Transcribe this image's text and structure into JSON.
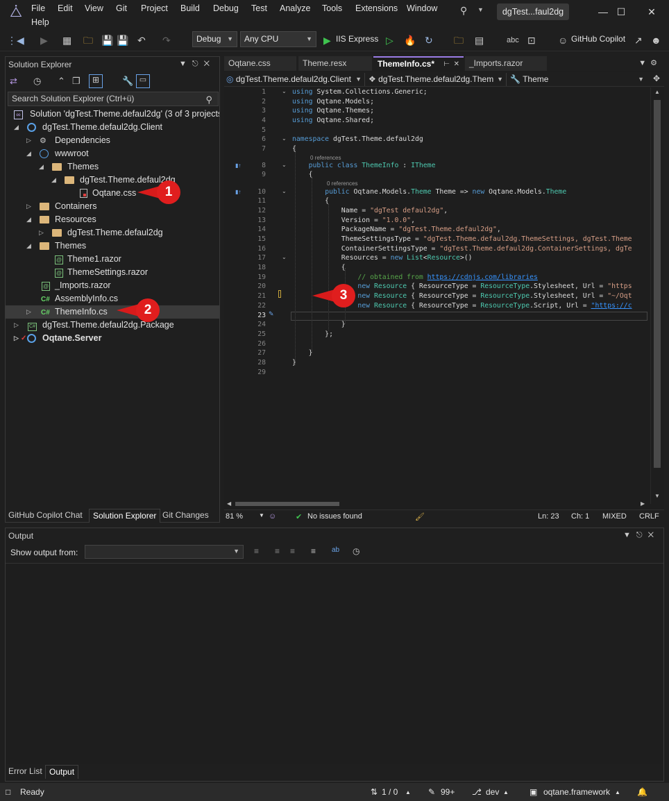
{
  "menu": {
    "items": [
      "File",
      "Edit",
      "View",
      "Git",
      "Project",
      "Build",
      "Debug",
      "Test",
      "Analyze",
      "Tools",
      "Extensions",
      "Window",
      "Help"
    ],
    "doc_title": "dgTest...faul2dg"
  },
  "toolbar": {
    "configuration": "Debug",
    "platform": "Any CPU",
    "run_target": "IIS Express",
    "copilot": "GitHub Copilot"
  },
  "solution_explorer": {
    "title": "Solution Explorer",
    "search_placeholder": "Search Solution Explorer (Ctrl+ü)",
    "rows": [
      {
        "label": "Solution 'dgTest.Theme.defaul2dg' (3 of 3 projects)"
      },
      {
        "label": "dgTest.Theme.defaul2dg.Client"
      },
      {
        "label": "Dependencies"
      },
      {
        "label": "wwwroot"
      },
      {
        "label": "Themes"
      },
      {
        "label": "dgTest.Theme.defaul2dg"
      },
      {
        "label": "Oqtane.css"
      },
      {
        "label": "Containers"
      },
      {
        "label": "Resources"
      },
      {
        "label": "dgTest.Theme.defaul2dg"
      },
      {
        "label": "Themes"
      },
      {
        "label": "Theme1.razor"
      },
      {
        "label": "ThemeSettings.razor"
      },
      {
        "label": "_Imports.razor"
      },
      {
        "label": "AssemblyInfo.cs"
      },
      {
        "label": "ThemeInfo.cs"
      },
      {
        "label": "dgTest.Theme.defaul2dg.Package"
      },
      {
        "label": "Oqtane.Server"
      }
    ],
    "bottom_tabs": [
      "GitHub Copilot Chat",
      "Solution Explorer",
      "Git Changes"
    ]
  },
  "callouts": [
    "1",
    "2",
    "3"
  ],
  "editor": {
    "tabs": [
      "Oqtane.css",
      "Theme.resx",
      "ThemeInfo.cs*",
      "_Imports.razor"
    ],
    "nav_project": "dgTest.Theme.defaul2dg.Client",
    "nav_class": "dgTest.Theme.defaul2dg.Them",
    "nav_member": "Theme",
    "codelens": "0 references",
    "status": {
      "zoom": "81 %",
      "issues": "No issues found",
      "line": "Ln: 23",
      "col": "Ch: 1",
      "whitespace": "MIXED",
      "line_ending": "CRLF"
    }
  },
  "output": {
    "title": "Output",
    "show_from_label": "Show output from:",
    "bottom_tabs": [
      "Error List",
      "Output"
    ]
  },
  "statusbar": {
    "ready": "Ready",
    "position": "1 / 0",
    "count": "99+",
    "branch": "dev",
    "repo": "oqtane.framework"
  }
}
